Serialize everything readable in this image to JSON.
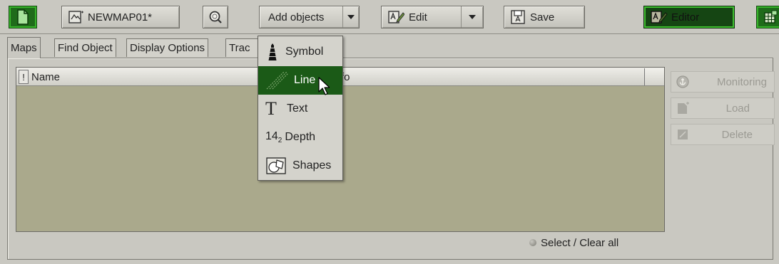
{
  "toolbar": {
    "map_name": "NEWMAP01*",
    "add_objects_label": "Add objects",
    "edit_label": "Edit",
    "save_label": "Save",
    "editor_label": "Editor"
  },
  "tabs": [
    "Maps",
    "Find Object",
    "Display Options",
    "Trac"
  ],
  "table": {
    "col_flag": "!",
    "col_name": "Name",
    "col_info": "fo"
  },
  "side_buttons": {
    "monitoring": "Monitoring",
    "load": "Load",
    "delete": "Delete"
  },
  "footer": {
    "select_clear": "Select / Clear all"
  },
  "add_menu": {
    "items": [
      "Symbol",
      "Line",
      "Text",
      "Depth",
      "Shapes"
    ],
    "selected": "Line",
    "depth_prefix": "14",
    "depth_sub": "2"
  },
  "colors": {
    "selected_green": "#1b5a17",
    "map_bg": "#aaa98c"
  }
}
